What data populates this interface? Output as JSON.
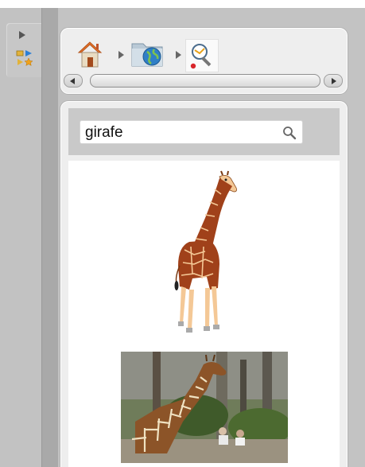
{
  "search": {
    "query": "girafe",
    "icon": "magnifier-icon"
  },
  "breadcrumb": {
    "items": [
      {
        "name": "home",
        "icon": "home-icon"
      },
      {
        "name": "web-folder",
        "icon": "globe-folder-icon"
      },
      {
        "name": "search",
        "icon": "search-page-icon"
      }
    ]
  },
  "results": [
    {
      "kind": "clipart",
      "subject": "giraffe"
    },
    {
      "kind": "photo",
      "subject": "giraffe"
    }
  ],
  "colors": {
    "panel": "#eeeeee",
    "background": "#c3c3c3",
    "giraffe_spots": "#a0411a",
    "giraffe_base": "#f4c896"
  }
}
